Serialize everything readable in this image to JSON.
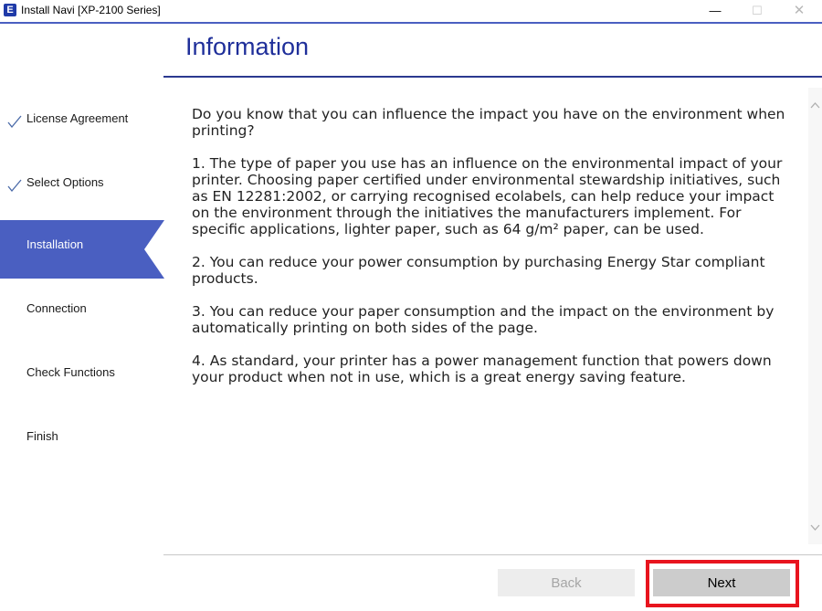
{
  "window": {
    "app_icon_letter": "E",
    "title": "Install Navi [XP-2100 Series]",
    "controls": {
      "minimize": "—",
      "maximize": "☐",
      "close": "✕"
    }
  },
  "sidebar": {
    "steps": [
      {
        "label": "License Agreement",
        "state": "completed"
      },
      {
        "label": "Select Options",
        "state": "completed"
      },
      {
        "label": "Installation",
        "state": "active"
      },
      {
        "label": "Connection",
        "state": "pending"
      },
      {
        "label": "Check Functions",
        "state": "pending"
      },
      {
        "label": "Finish",
        "state": "pending"
      }
    ]
  },
  "main": {
    "title": "Information",
    "paragraphs": [
      "Do you know that you can influence the impact you have on the environment when printing?",
      "1. The type of paper you use has an influence on the environmental impact of your printer. Choosing paper certified under environmental stewardship initiatives, such as EN 12281:2002, or carrying recognised ecolabels, can help reduce your impact on the environment through the initiatives the manufacturers implement. For specific applications, lighter paper, such as 64 g/m² paper, can be used.",
      "2. You can reduce your power consumption by purchasing Energy Star compliant products.",
      "3. You can reduce your paper consumption and the impact on the environment by automatically printing on both sides of the page.",
      "4. As standard, your printer has a power management function that powers down your product when not in use, which is a great energy saving feature."
    ]
  },
  "footer": {
    "back_label": "Back",
    "back_enabled": false,
    "next_label": "Next"
  },
  "colors": {
    "accent": "#4a5fc1",
    "title": "#1f2f9a",
    "highlight": "#e8141e"
  }
}
